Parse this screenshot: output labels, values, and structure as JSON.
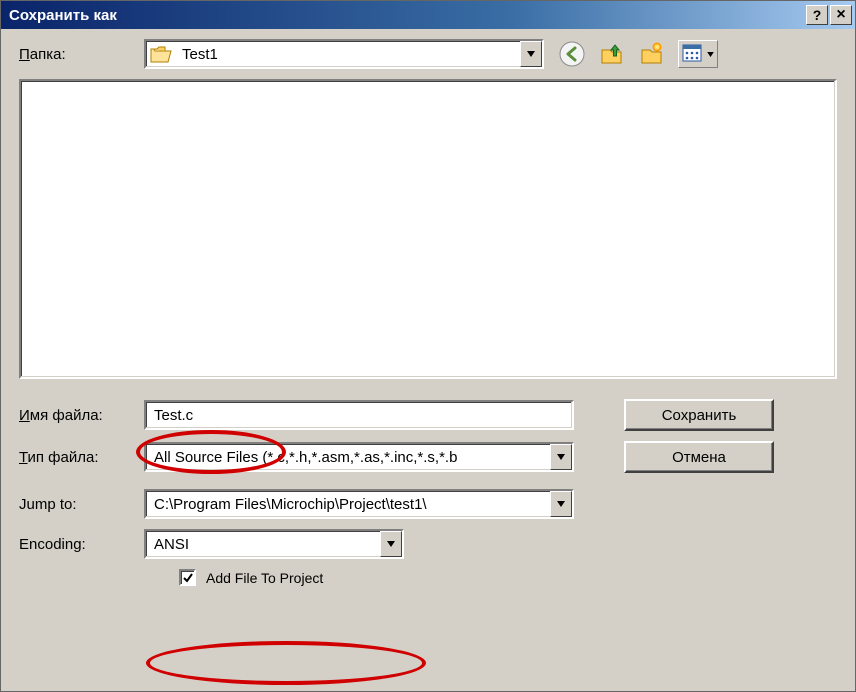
{
  "window": {
    "title": "Сохранить как"
  },
  "folder": {
    "label_u": "П",
    "label_rest": "апка:",
    "value": "Test1"
  },
  "filename": {
    "label_u": "И",
    "label_rest": "мя файла:",
    "value": "Test.c"
  },
  "filetype": {
    "label_u": "Т",
    "label_rest": "ип файла:",
    "value": "All Source Files (*.c,*.h,*.asm,*.as,*.inc,*.s,*.b"
  },
  "jumpto": {
    "label": "Jump to:",
    "value": "C:\\Program Files\\Microchip\\Project\\test1\\"
  },
  "encoding": {
    "label": "Encoding:",
    "value": "ANSI"
  },
  "checkbox": {
    "label": "Add File To Project",
    "checked": true
  },
  "buttons": {
    "save": "Сохранить",
    "cancel": "Отмена"
  },
  "titlebar": {
    "help": "?",
    "close": "×"
  }
}
